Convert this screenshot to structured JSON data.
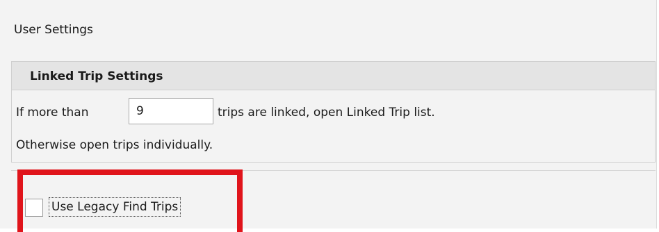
{
  "panel": {
    "title": "User Settings"
  },
  "linked_trip_group": {
    "header": "Linked Trip Settings",
    "row1_prefix": "If more than",
    "threshold_value": "9",
    "row1_suffix": "trips are linked, open Linked Trip list.",
    "row2": "Otherwise open trips individually."
  },
  "legacy": {
    "checkbox_label": "Use Legacy Find Trips",
    "checked": false
  },
  "colors": {
    "highlight": "#e0141b",
    "panel_bg": "#f3f3f3",
    "header_bg": "#e4e4e4"
  }
}
